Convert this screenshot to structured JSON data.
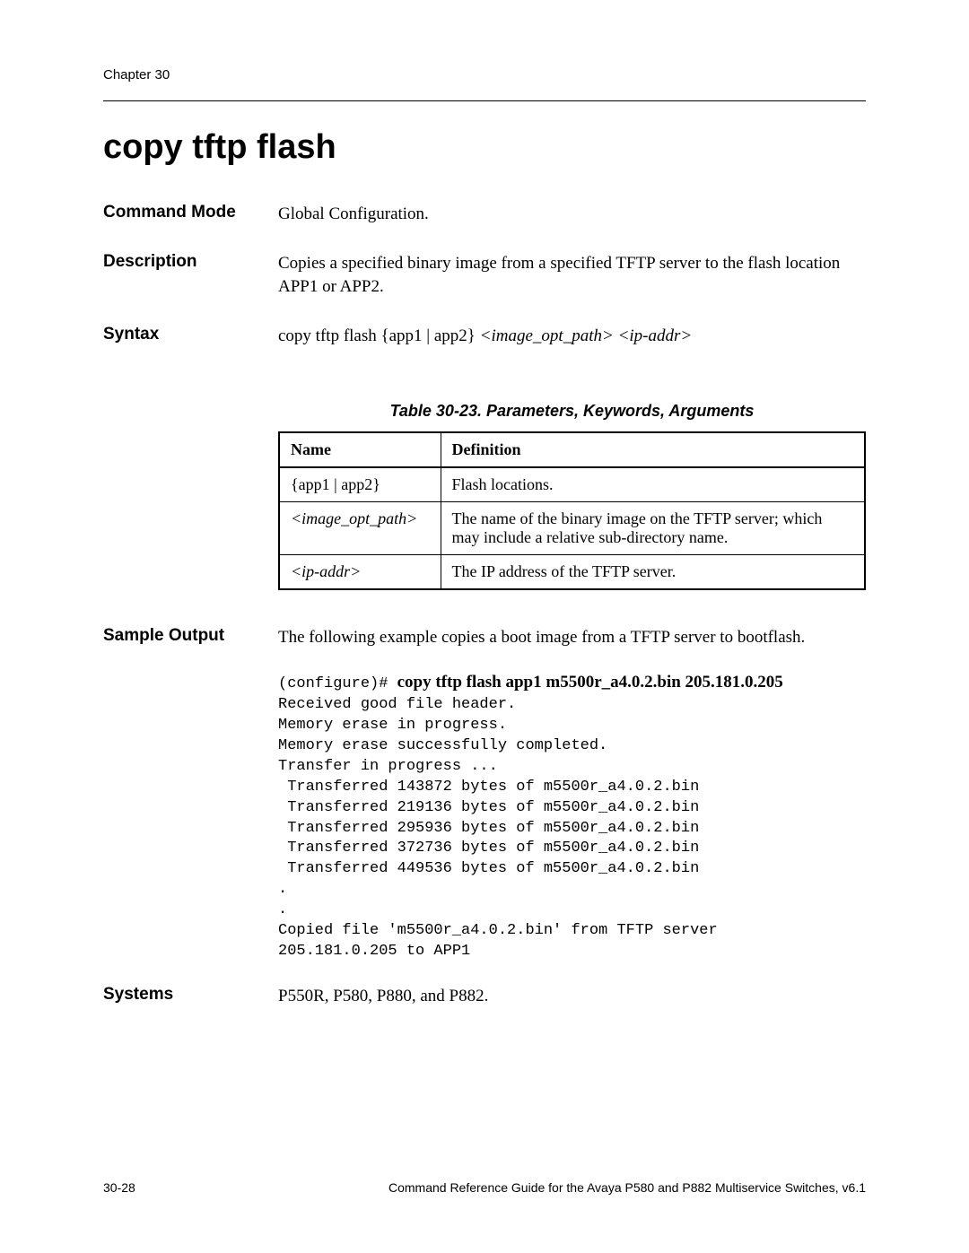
{
  "header": {
    "chapter": "Chapter 30"
  },
  "title": "copy tftp flash",
  "fields": {
    "command_mode": {
      "label": "Command Mode",
      "value": "Global Configuration."
    },
    "description": {
      "label": "Description",
      "value": "Copies a specified binary image from a specified TFTP server to the flash location APP1 or APP2."
    },
    "syntax": {
      "label": "Syntax",
      "prefix": "copy tftp flash {app1 | app2} ",
      "arg1": "<image_opt_path>",
      "arg2": "<ip-addr>"
    }
  },
  "table": {
    "caption": "Table 30-23.  Parameters, Keywords, Arguments",
    "headers": {
      "name": "Name",
      "definition": "Definition"
    },
    "rows": [
      {
        "name": "{app1 | app2}",
        "name_italic": false,
        "def": "Flash locations."
      },
      {
        "name": "<image_opt_path>",
        "name_italic": true,
        "def": "The name of the binary image on the TFTP server; which may include a relative sub-directory name."
      },
      {
        "name": "<ip-addr>",
        "name_italic": true,
        "def": "The IP address of the TFTP server."
      }
    ]
  },
  "sample": {
    "label": "Sample Output",
    "intro": "The following example copies a boot image from a TFTP server to bootflash.",
    "prompt": "(configure)# ",
    "command": "copy tftp flash app1 m5500r_a4.0.2.bin 205.181.0.205",
    "output": "Received good file header.\nMemory erase in progress.\nMemory erase successfully completed.\nTransfer in progress ...\n Transferred 143872 bytes of m5500r_a4.0.2.bin\n Transferred 219136 bytes of m5500r_a4.0.2.bin\n Transferred 295936 bytes of m5500r_a4.0.2.bin\n Transferred 372736 bytes of m5500r_a4.0.2.bin\n Transferred 449536 bytes of m5500r_a4.0.2.bin\n.\n.\nCopied file 'm5500r_a4.0.2.bin' from TFTP server\n205.181.0.205 to APP1"
  },
  "systems": {
    "label": "Systems",
    "value": "P550R, P580, P880, and P882."
  },
  "footer": {
    "page": "30-28",
    "text": "Command Reference Guide for the Avaya P580 and P882 Multiservice Switches, v6.1"
  }
}
